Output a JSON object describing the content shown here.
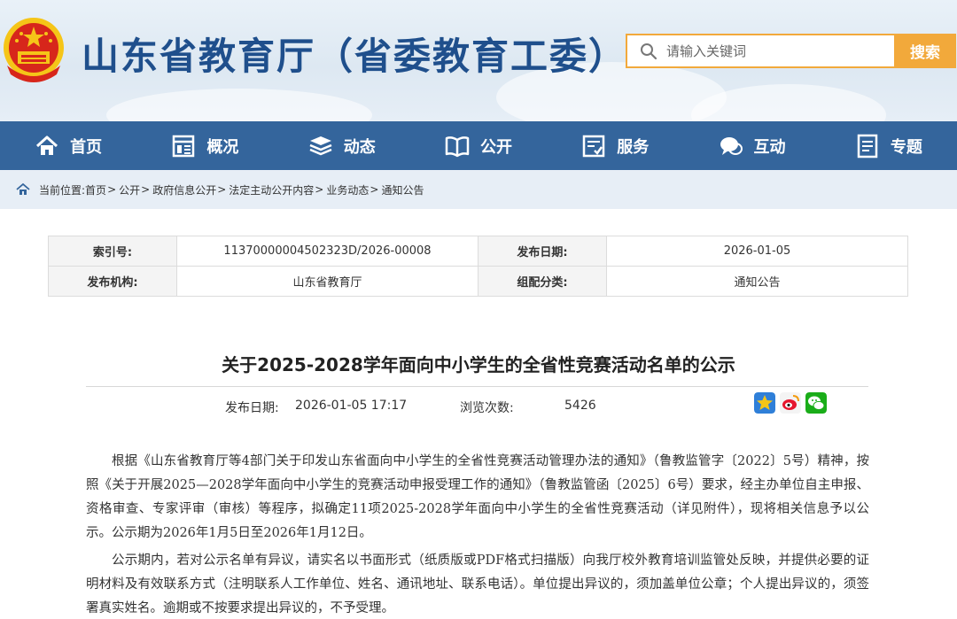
{
  "header": {
    "site_title": "山东省教育厅（省委教育工委）",
    "search_placeholder": "请输入关键词",
    "search_button": "搜索"
  },
  "nav": {
    "items": [
      {
        "label": "首页",
        "icon": "home-icon"
      },
      {
        "label": "概况",
        "icon": "overview-icon"
      },
      {
        "label": "动态",
        "icon": "news-icon"
      },
      {
        "label": "公开",
        "icon": "open-book-icon"
      },
      {
        "label": "服务",
        "icon": "service-icon"
      },
      {
        "label": "互动",
        "icon": "chat-icon"
      },
      {
        "label": "专题",
        "icon": "topic-icon"
      }
    ]
  },
  "breadcrumb": {
    "prefix": "当前位置:",
    "items": [
      "首页",
      "公开",
      "政府信息公开",
      "法定主动公开内容",
      "业务动态",
      "通知公告"
    ]
  },
  "info": {
    "index_label": "索引号:",
    "index_value": "11370000004502323D/2026-00008",
    "pub_date_label": "发布日期:",
    "pub_date_value": "2026-01-05",
    "org_label": "发布机构:",
    "org_value": "山东省教育厅",
    "category_label": "组配分类:",
    "category_value": "通知公告"
  },
  "article": {
    "title": "关于2025-2028学年面向中小学生的全省性竞赛活动名单的公示",
    "date_label": "发布日期:",
    "date_value": "2026-01-05 17:17",
    "views_label": "浏览次数:",
    "views_value": "5426",
    "paragraphs": [
      "根据《山东省教育厅等4部门关于印发山东省面向中小学生的全省性竞赛活动管理办法的通知》（鲁教监管字〔2022〕5号）精神，按照《关于开展2025—2028学年面向中小学生的竞赛活动申报受理工作的通知》（鲁教监管函〔2025〕6号）要求，经主办单位自主申报、资格审查、专家评审（审核）等程序，拟确定11项2025-2028学年面向中小学生的全省性竞赛活动（详见附件），现将相关信息予以公示。公示期为2026年1月5日至2026年1月12日。",
      "公示期内，若对公示名单有异议，请实名以书面形式（纸质版或PDF格式扫描版）向我厅校外教育培训监管处反映，并提供必要的证明材料及有效联系方式（注明联系人工作单位、姓名、通讯地址、联系电话）。单位提出异议的，须加盖单位公章；个人提出异议的，须签署真实姓名。逾期或不按要求提出异议的，不予受理。"
    ]
  },
  "colors": {
    "brand_blue": "#1f4f8c",
    "nav_blue": "#34659c",
    "accent_orange": "#f2a93b",
    "emblem_red": "#d7261b",
    "emblem_gold": "#f5c518"
  }
}
